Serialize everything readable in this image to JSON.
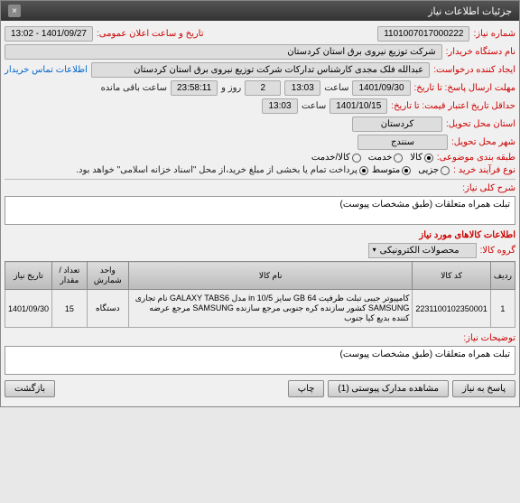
{
  "titlebar": {
    "title": "جزئیات اطلاعات نیاز",
    "close": "×"
  },
  "fields": {
    "need_no_lbl": "شماره نیاز:",
    "need_no": "1101007017000222",
    "pub_dt_lbl": "تاریخ و ساعت اعلان عمومی:",
    "pub_dt": "1401/09/27 - 13:02",
    "buyer_lbl": "نام دستگاه خریدار:",
    "buyer": "شرکت توزیع نیروی برق استان کردستان",
    "requester_lbl": "ایجاد کننده درخواست:",
    "requester": "عبدالله فلک مجدی کارشناس تدارکات شرکت توزیع نیروی برق استان کردستان",
    "contact_link": "اطلاعات تماس خریدار",
    "reply_deadline_lbl": "مهلت ارسال پاسخ: تا تاریخ:",
    "reply_date": "1401/09/30",
    "time_lbl": "ساعت",
    "reply_time": "13:03",
    "days_remain": "2",
    "days_lbl": "روز و",
    "time_remain": "23:58:11",
    "remain_lbl": "ساعت باقی مانده",
    "quote_valid_lbl": "حداقل تاریخ اعتبار قیمت: تا تاریخ:",
    "quote_date": "1401/10/15",
    "quote_time": "13:03",
    "province_lbl": "استان محل تحویل:",
    "province": "کردستان",
    "city_lbl": "شهر محل تحویل:",
    "city": "سنندج",
    "category_lbl": "طبقه بندی موضوعی:",
    "cat_goods": "کالا",
    "cat_service": "خدمت",
    "cat_goods_service": "کالا/خدمت",
    "process_lbl": "نوع فرآیند خرید :",
    "proc_low": "جزیی",
    "proc_mid": "متوسط",
    "pay_note": "پرداخت تمام یا بخشی از مبلغ خرید،از محل \"اسناد خزانه اسلامی\" خواهد بود.",
    "need_desc_lbl": "شرح کلی نیاز:",
    "need_desc": "تبلت  همراه متعلقات (طبق مشخصات پیوست)",
    "items_title": "اطلاعات کالاهای مورد نیاز",
    "goods_group_lbl": "گروه کالا:",
    "goods_group": "محصولات الکترونیکی",
    "notes_lbl": "توضیحات نیاز:",
    "notes": "تبلت  همراه متعلقات (طبق مشخصات پیوست)"
  },
  "table": {
    "headers": [
      "ردیف",
      "کد کالا",
      "نام کالا",
      "واحد شمارش",
      "تعداد / مقدار",
      "تاریخ نیاز"
    ],
    "rows": [
      {
        "idx": "1",
        "code": "2231100102350001",
        "name": "کامپیوتر جیبی تبلت ظرفیت GB 64 سایز in 10/5 مدل GALAXY TABS6 نام تجاری SAMSUNG کشور سازنده کره جنوبی مرجع سازنده SAMSUNG مرجع عرضه کننده بدیع کیا جنوب",
        "unit": "دستگاه",
        "qty": "15",
        "date": "1401/09/30"
      }
    ]
  },
  "buttons": {
    "reply": "پاسخ به نیاز",
    "attachments": "مشاهده مدارک پیوستی (1)",
    "print": "چاپ",
    "back": "بازگشت"
  }
}
